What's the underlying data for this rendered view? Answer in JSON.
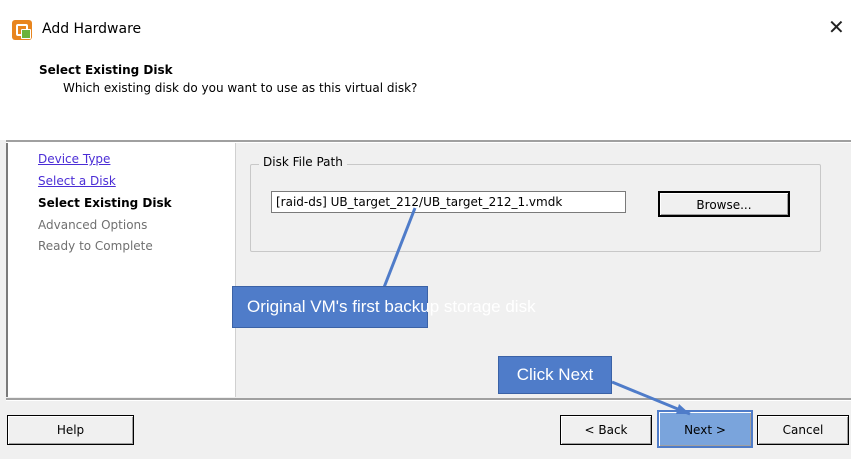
{
  "window": {
    "title": "Add Hardware",
    "close_glyph": "✕"
  },
  "header": {
    "title": "Select Existing Disk",
    "subtitle": "Which existing disk do you want to use as this virtual disk?"
  },
  "nav": {
    "items": [
      {
        "label": "Device Type",
        "state": "link"
      },
      {
        "label": "Select a Disk",
        "state": "link"
      },
      {
        "label": "Select Existing Disk",
        "state": "current"
      },
      {
        "label": "Advanced Options",
        "state": "future"
      },
      {
        "label": "Ready to Complete",
        "state": "future"
      }
    ]
  },
  "disk": {
    "group_label": "Disk File Path",
    "path_value": "[raid-ds] UB_target_212/UB_target_212_1.vmdk",
    "browse_label": "Browse..."
  },
  "footer": {
    "help_label": "Help",
    "back_label": "< Back",
    "next_label": "Next >",
    "cancel_label": "Cancel"
  },
  "annotations": {
    "disk_callout": "Original VM's first backup storage disk",
    "next_callout": "Click Next",
    "callout_color": "#4f7cc9"
  },
  "colors": {
    "dialog_bg": "#f0f0f0",
    "link": "#4b2dd6",
    "icon_orange": "#e8851f",
    "icon_green": "#6bb33c"
  }
}
